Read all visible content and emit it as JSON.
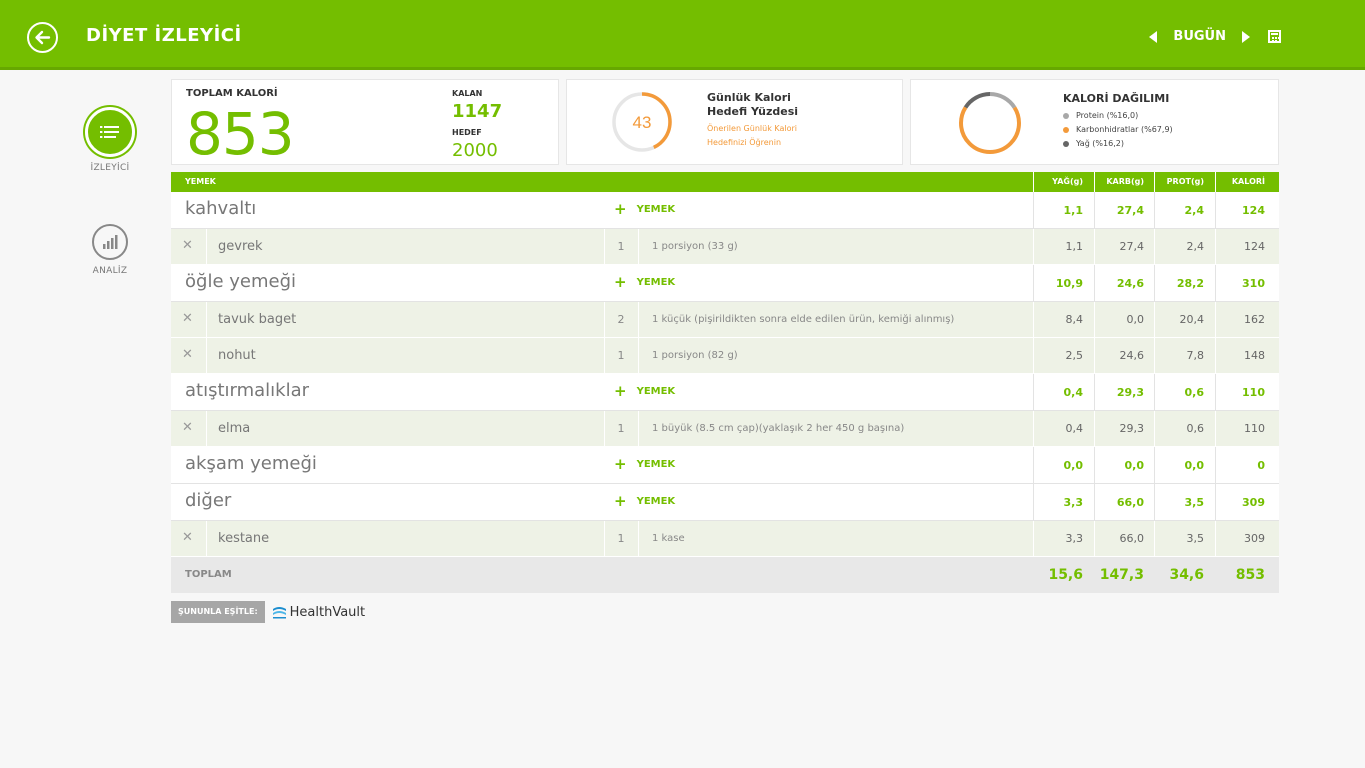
{
  "header": {
    "title": "DİYET İZLEYİCİ",
    "date_label": "BUGÜN"
  },
  "sidebar": {
    "items": [
      {
        "label": "İZLEYİCİ"
      },
      {
        "label": "ANALİZ"
      }
    ]
  },
  "summary": {
    "total_title": "TOPLAM KALORİ",
    "total_value": "853",
    "kalan_label": "KALAN",
    "kalan_value": "1147",
    "hedef_label": "HEDEF",
    "hedef_value": "2000"
  },
  "goal": {
    "percent": "43",
    "percent_fraction": 0.43,
    "title": "Günlük Kalori Hedefi Yüzdesi",
    "link_line1": "Önerilen Günlük Kalori",
    "link_line2": "Hedefinizi Öğrenin"
  },
  "distribution": {
    "title": "KALORİ DAĞILIMI",
    "legend": [
      {
        "label": "Protein (%16,0)",
        "color": "#a8a8a8",
        "fraction": 0.16
      },
      {
        "label": "Karbonhidratlar (%67,9)",
        "color": "#f39a3a",
        "fraction": 0.679
      },
      {
        "label": "Yağ (%16,2)",
        "color": "#666666",
        "fraction": 0.162
      }
    ]
  },
  "table": {
    "headers": {
      "food": "YEMEK",
      "fat": "YAĞ(g)",
      "carb": "KARB(g)",
      "prot": "PROT(g)",
      "cal": "KALORİ"
    },
    "add_label": "YEMEK",
    "rows": [
      {
        "type": "meal",
        "name": "kahvaltı",
        "fat": "1,1",
        "carb": "27,4",
        "prot": "2,4",
        "cal": "124"
      },
      {
        "type": "item",
        "name": "gevrek",
        "qty": "1",
        "portion": "1 porsiyon (33 g)",
        "fat": "1,1",
        "carb": "27,4",
        "prot": "2,4",
        "cal": "124"
      },
      {
        "type": "meal",
        "name": "öğle yemeği",
        "fat": "10,9",
        "carb": "24,6",
        "prot": "28,2",
        "cal": "310"
      },
      {
        "type": "item",
        "name": "tavuk baget",
        "qty": "2",
        "portion": "1 küçük (pişirildikten sonra elde edilen ürün, kemiği alınmış)",
        "fat": "8,4",
        "carb": "0,0",
        "prot": "20,4",
        "cal": "162"
      },
      {
        "type": "item",
        "name": "nohut",
        "qty": "1",
        "portion": "1 porsiyon (82 g)",
        "fat": "2,5",
        "carb": "24,6",
        "prot": "7,8",
        "cal": "148"
      },
      {
        "type": "meal",
        "name": "atıştırmalıklar",
        "fat": "0,4",
        "carb": "29,3",
        "prot": "0,6",
        "cal": "110"
      },
      {
        "type": "item",
        "name": "elma",
        "qty": "1",
        "portion": "1 büyük (8.5 cm çap)(yaklaşık 2 her 450 g başına)",
        "fat": "0,4",
        "carb": "29,3",
        "prot": "0,6",
        "cal": "110"
      },
      {
        "type": "meal",
        "name": "akşam yemeği",
        "fat": "0,0",
        "carb": "0,0",
        "prot": "0,0",
        "cal": "0"
      },
      {
        "type": "meal",
        "name": "diğer",
        "fat": "3,3",
        "carb": "66,0",
        "prot": "3,5",
        "cal": "309"
      },
      {
        "type": "item",
        "name": "kestane",
        "qty": "1",
        "portion": "1 kase",
        "fat": "3,3",
        "carb": "66,0",
        "prot": "3,5",
        "cal": "309"
      }
    ],
    "total": {
      "label": "TOPLAM",
      "fat": "15,6",
      "carb": "147,3",
      "prot": "34,6",
      "cal": "853"
    }
  },
  "sync": {
    "label": "ŞUNUNLA EŞİTLE:",
    "service": "HealthVault"
  },
  "colors": {
    "accent": "#74be00",
    "orange": "#f39a3a",
    "ring_bg": "#e6e6e6"
  }
}
